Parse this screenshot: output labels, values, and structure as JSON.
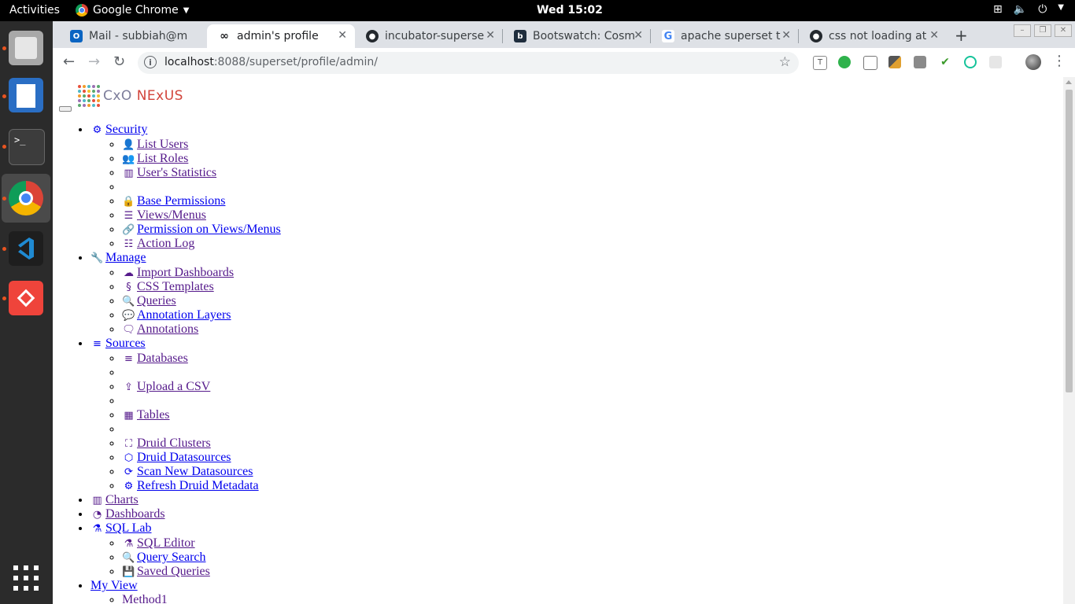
{
  "topbar": {
    "activities": "Activities",
    "app_name": "Google Chrome",
    "clock": "Wed 15:02"
  },
  "tabs": [
    {
      "label": "Mail - subbiah@m",
      "icon": "outlook-icon"
    },
    {
      "label": "admin's profile",
      "icon": "superset-icon"
    },
    {
      "label": "incubator-superse",
      "icon": "github-icon"
    },
    {
      "label": "Bootswatch: Cosm",
      "icon": "bootswatch-icon"
    },
    {
      "label": "apache superset t",
      "icon": "google-icon"
    },
    {
      "label": "css not loading at",
      "icon": "github-icon"
    }
  ],
  "address": {
    "host": "localhost",
    "rest": ":8088/superset/profile/admin/"
  },
  "logo": {
    "cxo": "CxO ",
    "nexus": "NExUS"
  },
  "menu": {
    "security": {
      "label": "Security",
      "items": [
        "List Users",
        "List Roles",
        "User's Statistics",
        "",
        "Base Permissions",
        "Views/Menus",
        "Permission on Views/Menus",
        "Action Log"
      ]
    },
    "manage": {
      "label": "Manage",
      "items": [
        "Import Dashboards",
        "CSS Templates",
        "Queries",
        "Annotation Layers",
        "Annotations"
      ]
    },
    "sources": {
      "label": "Sources",
      "items": [
        "Databases",
        "",
        "Upload a CSV",
        "",
        "Tables",
        "",
        "Druid Clusters",
        "Druid Datasources",
        "Scan New Datasources",
        "Refresh Druid Metadata"
      ]
    },
    "charts": {
      "label": "Charts"
    },
    "dashboards": {
      "label": "Dashboards"
    },
    "sqllab": {
      "label": "SQL Lab",
      "items": [
        "SQL Editor",
        "Query Search",
        "Saved Queries"
      ]
    },
    "myview": {
      "label": "My View",
      "items": [
        "Method1"
      ]
    }
  },
  "colors": {
    "link": "#0000ee",
    "visited": "#551a8b",
    "nexus_red": "#d2443b",
    "ubuntu_orange": "#e95420"
  }
}
